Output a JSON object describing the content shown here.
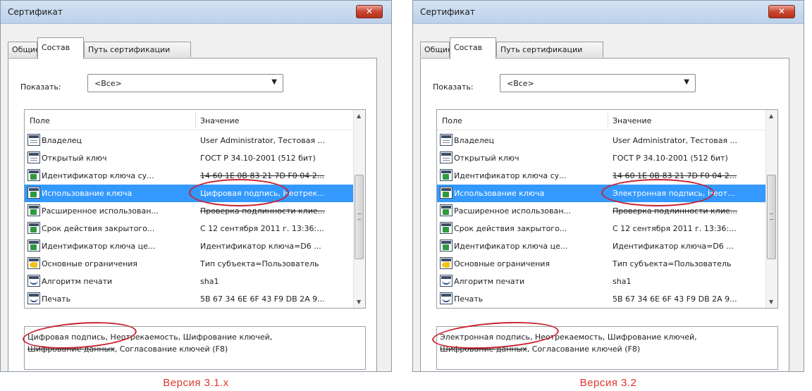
{
  "colors": {
    "selection": "#3399ff",
    "annotation": "#c9202d",
    "caption": "#e2342b",
    "close_button": "#c9462f"
  },
  "icons": {
    "close": "close-x-icon",
    "dropdown": "chevron-down-icon",
    "field": "certificate-field-icon",
    "extension": "certificate-extension-icon",
    "constraint": "key-constraint-icon",
    "signature": "signature-field-icon"
  },
  "panels": [
    {
      "dialog": {
        "title": "Сертификат",
        "close_glyph": "✕",
        "tabs": [
          "Общие",
          "Состав",
          "Путь сертификации"
        ],
        "show_label": "Показать:",
        "show_value": "<Все>",
        "column_field": "Поле",
        "column_value": "Значение",
        "rows": [
          {
            "field": "Владелец",
            "value": "User Administrator, Тестовая ...",
            "icon": "doc"
          },
          {
            "field": "Открытый ключ",
            "value": "ГОСТ Р 34.10-2001 (512 бит)",
            "icon": "doc"
          },
          {
            "field": "Идентификатор ключа су...",
            "value": "14 60 1E 0B 83 21 7D F0 04 2...",
            "icon": "ext"
          },
          {
            "field": "Использование ключа",
            "value": "Цифровая подпись, Неотрек...",
            "icon": "ext"
          },
          {
            "field": "Расширенное использован...",
            "value": "Проверка подлинности клие...",
            "icon": "ext"
          },
          {
            "field": "Срок действия закрытого...",
            "value": "С 12 сентября 2011 г. 13:36:...",
            "icon": "ext"
          },
          {
            "field": "Идентификатор ключа це...",
            "value": "Идентификатор ключа=D6 ...",
            "icon": "ext"
          },
          {
            "field": "Основные ограничения",
            "value": "Тип субъекта=Пользователь",
            "icon": "key"
          },
          {
            "field": "Алгоритм печати",
            "value": "sha1",
            "icon": "sig"
          },
          {
            "field": "Печать",
            "value": "5B 67 34 6E 6F 43 F9 DB 2A 9...",
            "icon": "sig"
          }
        ],
        "selected_row": 3,
        "detail": {
          "part1": "Цифровая подпись,",
          "part2": " Неотрекаемость, Шифрование ключей,",
          "part3": "Шифрование данных",
          "part4": ", Согласование ключей (F8)"
        }
      },
      "caption": "Версия 3.1.x"
    },
    {
      "dialog": {
        "title": "Сертификат",
        "close_glyph": "✕",
        "tabs": [
          "Общие",
          "Состав",
          "Путь сертификации"
        ],
        "show_label": "Показать:",
        "show_value": "<Все>",
        "column_field": "Поле",
        "column_value": "Значение",
        "rows": [
          {
            "field": "Владелец",
            "value": "User Administrator, Тестовая ...",
            "icon": "doc"
          },
          {
            "field": "Открытый ключ",
            "value": "ГОСТ Р 34.10-2001 (512 бит)",
            "icon": "doc"
          },
          {
            "field": "Идентификатор ключа су...",
            "value": "14 60 1E 0B 83 21 7D F0 04 2...",
            "icon": "ext"
          },
          {
            "field": "Использование ключа",
            "value": "Электронная подпись, Неот...",
            "icon": "ext"
          },
          {
            "field": "Расширенное использован...",
            "value": "Проверка подлинности клие...",
            "icon": "ext"
          },
          {
            "field": "Срок действия закрытого...",
            "value": "С 12 сентября 2011 г. 13:36:...",
            "icon": "ext"
          },
          {
            "field": "Идентификатор ключа це...",
            "value": "Идентификатор ключа=D6 ...",
            "icon": "ext"
          },
          {
            "field": "Основные ограничения",
            "value": "Тип субъекта=Пользователь",
            "icon": "key"
          },
          {
            "field": "Алгоритм печати",
            "value": "sha1",
            "icon": "sig"
          },
          {
            "field": "Печать",
            "value": "5B 67 34 6E 6F 43 F9 DB 2A 9...",
            "icon": "sig"
          }
        ],
        "selected_row": 3,
        "detail": {
          "part1": "Электронная подпись,",
          "part2": " Неотрекаемость, Шифрование ключей,",
          "part3": "Шифрование данных",
          "part4": ", Согласование ключей (F8)"
        }
      },
      "caption": "Версия 3.2"
    }
  ]
}
